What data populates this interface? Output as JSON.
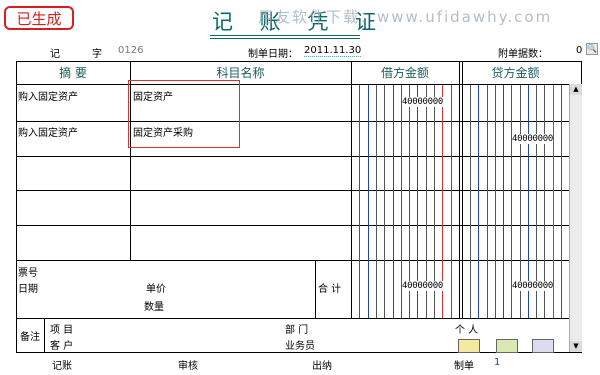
{
  "status_stamp": "已生成",
  "title": "记 账 凭 证",
  "watermark": "用友软件下载：www.ufidawhy.com",
  "header": {
    "voucher_word_label": "记",
    "zi_label": "字",
    "voucher_no": "0126",
    "date_label": "制单日期：",
    "date": "2011.11.30",
    "attach_label": "附单据数：",
    "attach_count": "0"
  },
  "columns": {
    "summary": "摘  要",
    "account": "科目名称",
    "debit": "借方金额",
    "credit": "贷方金额"
  },
  "rows": [
    {
      "summary": "购入固定资产",
      "account": "固定资产",
      "debit": "40000000",
      "credit": ""
    },
    {
      "summary": "购入固定资产",
      "account": "固定资产采购",
      "debit": "",
      "credit": "40000000"
    }
  ],
  "bottom": {
    "ticket_no_label": "票号",
    "date_label": "日期",
    "unit_price_label": "单价",
    "quantity_label": "数量",
    "total_label": "合 计",
    "debit_total": "40000000",
    "credit_total": "40000000",
    "remark_label": "备注",
    "project_label": "项  目",
    "customer_label": "客  户",
    "dept_label": "部  门",
    "person_label": "个  人",
    "salesman_label": "业务员"
  },
  "footer": {
    "bookkeep_label": "记账",
    "review_label": "审核",
    "cashier_label": "出纳",
    "maker_label": "制单",
    "maker_value": "1"
  }
}
